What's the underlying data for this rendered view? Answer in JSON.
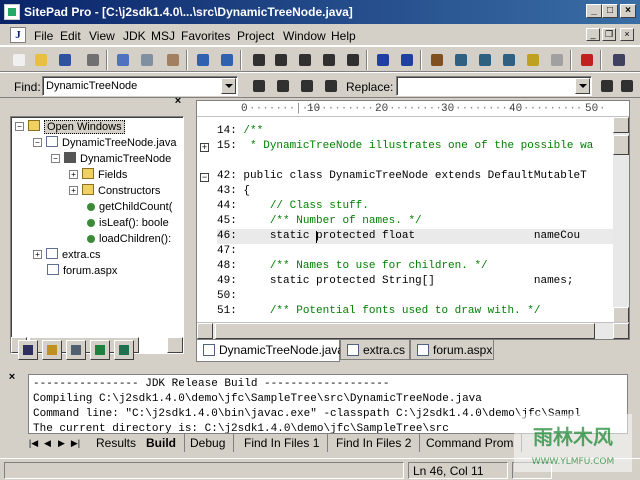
{
  "window": {
    "title": "SitePad Pro - [C:\\j2sdk1.4.0\\...\\src\\DynamicTreeNode.java]",
    "controls": {
      "minimize": "_",
      "maximize": "□",
      "close": "×"
    }
  },
  "menubar": {
    "items": [
      "File",
      "Edit",
      "View",
      "JDK",
      "MSJ",
      "Favorites",
      "Project",
      "Window",
      "Help"
    ],
    "doc_icon": "J"
  },
  "findbar": {
    "find_label": "Find:",
    "find_value": "DynamicTreeNode",
    "replace_label": "Replace:",
    "replace_value": ""
  },
  "tree": {
    "nodes": [
      {
        "label": "Open Windows",
        "icon": "folder-icon"
      },
      {
        "label": "DynamicTreeNode.java",
        "icon": "java-file-icon"
      },
      {
        "label": "DynamicTreeNode",
        "icon": "class-icon"
      },
      {
        "label": "Fields",
        "icon": "folder-icon"
      },
      {
        "label": "Constructors",
        "icon": "folder-icon"
      },
      {
        "label": "getChildCount(",
        "icon": "method-icon"
      },
      {
        "label": "isLeaf(): boole",
        "icon": "method-icon"
      },
      {
        "label": "loadChildren():",
        "icon": "method-icon"
      },
      {
        "label": "extra.cs",
        "icon": "cs-file-icon"
      },
      {
        "label": "forum.aspx",
        "icon": "aspx-file-icon"
      }
    ]
  },
  "editor": {
    "ruler": [
      "0",
      "10",
      "20",
      "30",
      "40",
      "50"
    ],
    "lines": [
      {
        "num": "14:",
        "text": "/**",
        "type": "comment"
      },
      {
        "num": "15:",
        "text": " * DynamicTreeNode illustrates one of the possible wa",
        "type": "comment"
      },
      {
        "num": "",
        "text": "",
        "type": "blank"
      },
      {
        "num": "42:",
        "text": "public class DynamicTreeNode extends DefaultMutableT",
        "type": "code"
      },
      {
        "num": "43:",
        "text": "{",
        "type": "code"
      },
      {
        "num": "44:",
        "text": "    // Class stuff.",
        "type": "comment"
      },
      {
        "num": "45:",
        "text": "    /** Number of names. */",
        "type": "comment"
      },
      {
        "num": "46:",
        "text": "    static protected float                  nameCou",
        "type": "current"
      },
      {
        "num": "47:",
        "text": "",
        "type": "blank"
      },
      {
        "num": "48:",
        "text": "    /** Names to use for children. */",
        "type": "comment"
      },
      {
        "num": "49:",
        "text": "    static protected String[]               names;",
        "type": "code"
      },
      {
        "num": "50:",
        "text": "",
        "type": "blank"
      },
      {
        "num": "51:",
        "text": "    /** Potential fonts used to draw with. */",
        "type": "comment"
      }
    ],
    "tabs": [
      "DynamicTreeNode.java",
      "extra.cs",
      "forum.aspx"
    ]
  },
  "output": {
    "lines": [
      "---------------- JDK Release Build -------------------",
      "Compiling C:\\j2sdk1.4.0\\demo\\jfc\\SampleTree\\src\\DynamicTreeNode.java",
      "Command line: \"C:\\j2sdk1.4.0\\bin\\javac.exe\" -classpath C:\\j2sdk1.4.0\\demo\\jfc\\Sampl",
      "The current directory is: C:\\j2sdk1.4.0\\demo\\jfc\\SampleTree\\src"
    ],
    "tabs": [
      "Results",
      "Build",
      "Debug",
      "Find In Files 1",
      "Find In Files 2",
      "Command Prom"
    ],
    "active_tab": "Build"
  },
  "status": {
    "position": "Ln 46, Col 11"
  },
  "watermark": {
    "brand": "雨林木风",
    "url": "WWW.YLMFU.COM"
  },
  "colors": {
    "title_bar": "#0a246a",
    "comment": "#008000",
    "chrome": "#d4d0c8"
  }
}
